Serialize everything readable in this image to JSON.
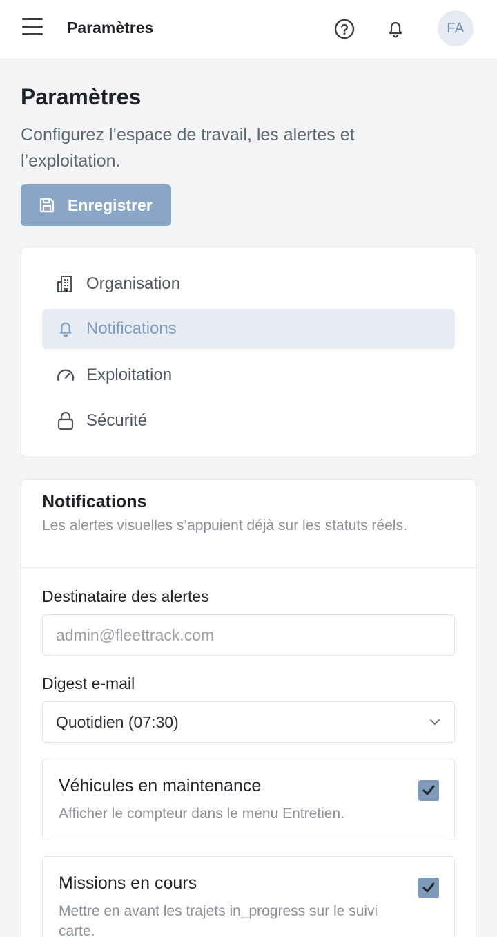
{
  "topbar": {
    "title": "Paramètres",
    "avatar_initials": "FA"
  },
  "header": {
    "title": "Paramètres",
    "description": "Configurez l’espace de travail, les alertes et l’exploitation.",
    "save_label": "Enregistrer"
  },
  "nav": {
    "items": [
      {
        "label": "Organisation",
        "icon": "building-icon"
      },
      {
        "label": "Notifications",
        "icon": "bell-icon",
        "active": true
      },
      {
        "label": "Exploitation",
        "icon": "gauge-icon"
      },
      {
        "label": "Sécurité",
        "icon": "lock-icon"
      }
    ]
  },
  "notifications": {
    "title": "Notifications",
    "description": "Les alertes visuelles s’appuient déjà sur les statuts réels.",
    "recipient": {
      "label": "Destinataire des alertes",
      "placeholder": "admin@fleettrack.com"
    },
    "digest": {
      "label": "Digest e-mail",
      "value": "Quotidien (07:30)"
    },
    "options": [
      {
        "title": "Véhicules en maintenance",
        "description": "Afficher le compteur dans le menu Entretien.",
        "checked": true
      },
      {
        "title": "Missions en cours",
        "description": "Mettre en avant les trajets in_progress sur le suivi carte.",
        "checked": true
      }
    ]
  },
  "colors": {
    "accent": "#8aa6c6",
    "active_bg": "#e7ecf3",
    "checkbox": "#7f9aba"
  }
}
